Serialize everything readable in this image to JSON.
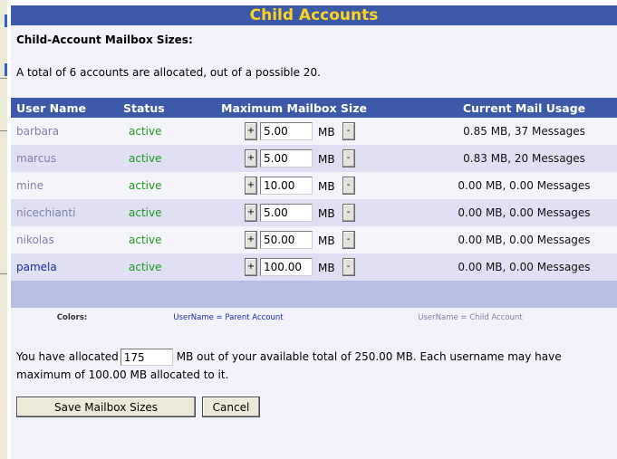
{
  "panel": {
    "title": "Child Accounts",
    "heading": "Child-Account Mailbox Sizes:",
    "summary": "A total of 6 accounts are allocated, out of a possible 20."
  },
  "table": {
    "headers": {
      "user": "User Name",
      "status": "Status",
      "max": "Maximum Mailbox Size",
      "usage": "Current Mail Usage"
    },
    "unit_label": "MB",
    "plus_label": "+",
    "minus_label": "-",
    "rows": [
      {
        "user": "barbara",
        "status": "active",
        "size": "5.00",
        "usage": "0.85 MB, 37 Messages",
        "type": "child"
      },
      {
        "user": "marcus",
        "status": "active",
        "size": "5.00",
        "usage": "0.83 MB, 20 Messages",
        "type": "child"
      },
      {
        "user": "mine",
        "status": "active",
        "size": "10.00",
        "usage": "0.00 MB, 0.00 Messages",
        "type": "child"
      },
      {
        "user": "nicechianti",
        "status": "active",
        "size": "5.00",
        "usage": "0.00 MB, 0.00 Messages",
        "type": "child"
      },
      {
        "user": "nikolas",
        "status": "active",
        "size": "50.00",
        "usage": "0.00 MB, 0.00 Messages",
        "type": "child"
      },
      {
        "user": "pamela",
        "status": "active",
        "size": "100.00",
        "usage": "0.00 MB, 0.00 Messages",
        "type": "parent"
      }
    ]
  },
  "legend": {
    "label": "Colors:",
    "parent": "UserName = Parent Account",
    "child": "UserName = Child Account"
  },
  "allocation": {
    "prefix": "You have allocated",
    "value": "175",
    "suffix": "MB out of your available total of 250.00 MB. Each username may have",
    "line2": "maximum of 100.00 MB allocated to it."
  },
  "actions": {
    "save_label": "Save Mailbox Sizes",
    "cancel_label": "Cancel"
  },
  "colors": {
    "header_bg": "#3d5aa8",
    "title_text": "#ffd21f",
    "parent_user": "#1b2aa8",
    "child_user": "#7a82a8",
    "status_active": "#1c9a1c"
  }
}
